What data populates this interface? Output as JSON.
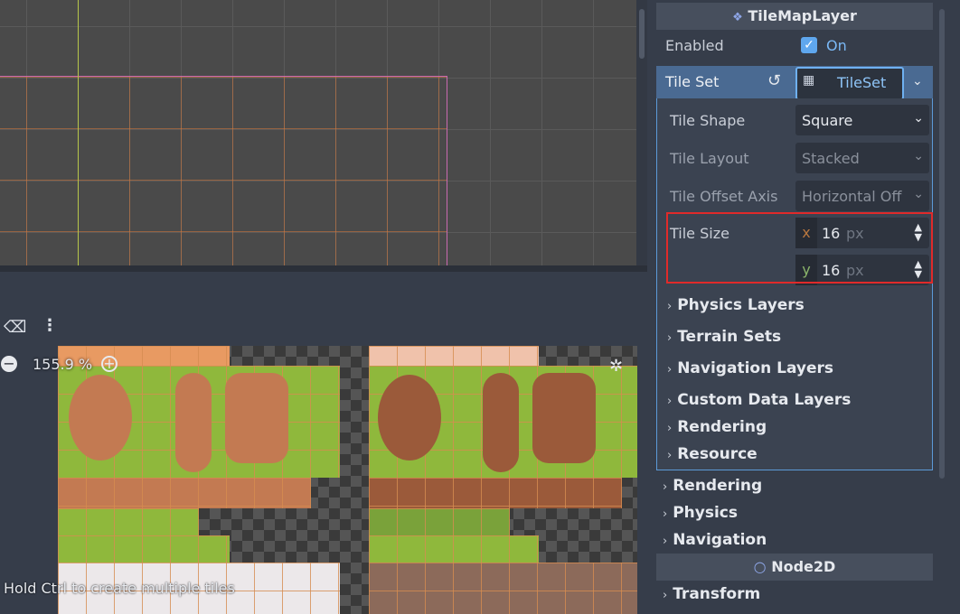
{
  "viewport": {},
  "tile_panel": {
    "zoom_label": "155.9 %",
    "hint": "Hold Ctrl to create multiple tiles"
  },
  "inspector": {
    "section_title": "TileMapLayer",
    "enabled_label": "Enabled",
    "enabled_value": "On",
    "tile_set_label": "Tile Set",
    "tile_set_resource": "TileSet",
    "tile_shape": {
      "label": "Tile Shape",
      "value": "Square"
    },
    "tile_layout": {
      "label": "Tile Layout",
      "value": "Stacked"
    },
    "tile_offset_axis": {
      "label": "Tile Offset Axis",
      "value": "Horizontal Off"
    },
    "tile_size": {
      "label": "Tile Size",
      "x_axis": "x",
      "x_value": "16",
      "y_axis": "y",
      "y_value": "16",
      "unit": "px"
    },
    "tileset_groups": [
      "Physics Layers",
      "Terrain Sets",
      "Navigation Layers",
      "Custom Data Layers",
      "Rendering",
      "Resource"
    ],
    "groups": [
      "Rendering",
      "Physics",
      "Navigation"
    ],
    "node2d_title": "Node2D",
    "transform_label": "Transform"
  },
  "colors": {
    "accent": "#5fa7ee",
    "highlight_box": "#e02a2a",
    "tileset_row": "#4a6a92"
  }
}
